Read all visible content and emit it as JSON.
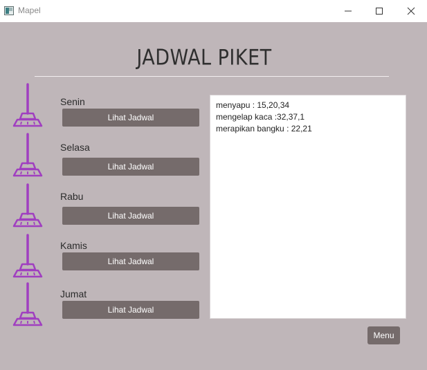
{
  "window": {
    "title": "Mapel"
  },
  "page": {
    "title": "JADWAL PIKET"
  },
  "days": [
    {
      "label": "Senin",
      "button": "Lihat Jadwal"
    },
    {
      "label": "Selasa",
      "button": "Lihat Jadwal"
    },
    {
      "label": "Rabu",
      "button": "Lihat Jadwal"
    },
    {
      "label": "Kamis",
      "button": "Lihat Jadwal"
    },
    {
      "label": "Jumat",
      "button": "Lihat Jadwal"
    }
  ],
  "schedule": {
    "lines": [
      "menyapu : 15,20,34",
      "mengelap kaca :32,37,1",
      "merapikan bangku : 22,21"
    ]
  },
  "menu_button": "Menu",
  "colors": {
    "background": "#bfb6b9",
    "button": "#756b6b",
    "broom": "#a03fc0"
  },
  "icons": {
    "day_icon": "broom-icon"
  }
}
